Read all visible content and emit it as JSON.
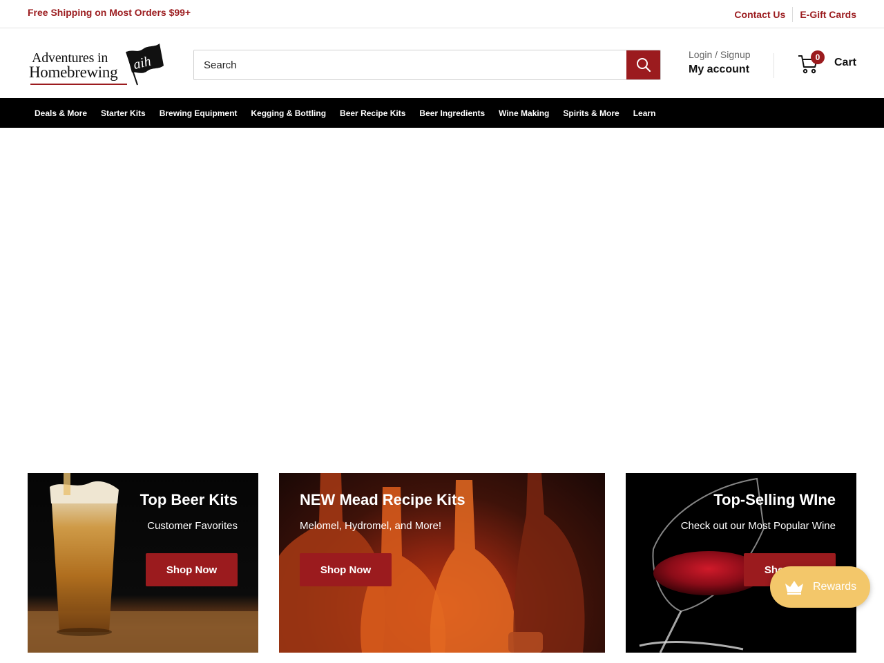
{
  "announcement": {
    "promo": "Free Shipping on Most Orders $99+",
    "links": [
      {
        "label": "Contact Us"
      },
      {
        "label": "E-Gift Cards"
      }
    ]
  },
  "header": {
    "logo": {
      "line1": "Adventures in",
      "line2": "Homebrewing",
      "badge": "aih"
    },
    "search": {
      "placeholder": "Search",
      "icon": "search-icon"
    },
    "account": {
      "login_label": "Login / Signup",
      "account_label": "My account"
    },
    "cart": {
      "count": "0",
      "label": "Cart",
      "icon": "cart-icon"
    }
  },
  "nav": {
    "items": [
      {
        "label": "Deals & More"
      },
      {
        "label": "Starter Kits"
      },
      {
        "label": "Brewing Equipment"
      },
      {
        "label": "Kegging & Bottling"
      },
      {
        "label": "Beer Recipe Kits"
      },
      {
        "label": "Beer Ingredients"
      },
      {
        "label": "Wine Making"
      },
      {
        "label": "Spirits & More"
      },
      {
        "label": "Learn"
      }
    ]
  },
  "promos": [
    {
      "title": "Top Beer Kits",
      "subtitle": "Customer Favorites",
      "button": "Shop Now"
    },
    {
      "title": "NEW Mead Recipe Kits",
      "subtitle": "Melomel, Hydromel, and More!",
      "button": "Shop Now"
    },
    {
      "title": "Top-Selling WIne",
      "subtitle": "Check out our Most Popular Wine",
      "button": "Shop Now"
    }
  ],
  "rewards": {
    "label": "Rewards",
    "icon": "crown-icon"
  },
  "colors": {
    "brand": "#9b1b1e",
    "nav_bg": "#000000",
    "rewards_bg": "#f3c76a"
  }
}
